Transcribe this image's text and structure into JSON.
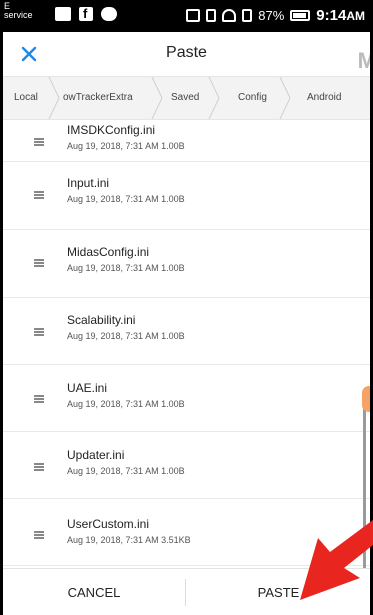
{
  "statusbar": {
    "carrier_line1": "E",
    "carrier_line2": "service",
    "battery": "87%",
    "time": "9:14",
    "ampm": "AM"
  },
  "dialog": {
    "title": "Paste",
    "background_text": "M",
    "breadcrumb": [
      "Local",
      "owTrackerExtra",
      "Saved",
      "Config",
      "Android"
    ],
    "files": [
      {
        "name": "IMSDKConfig.ini",
        "meta": "Aug 19, 2018, 7:31 AM 1.00B"
      },
      {
        "name": "Input.ini",
        "meta": "Aug 19, 2018, 7:31 AM 1.00B"
      },
      {
        "name": "MidasConfig.ini",
        "meta": "Aug 19, 2018, 7:31 AM 1.00B"
      },
      {
        "name": "Scalability.ini",
        "meta": "Aug 19, 2018, 7:31 AM 1.00B"
      },
      {
        "name": "UAE.ini",
        "meta": "Aug 19, 2018, 7:31 AM 1.00B"
      },
      {
        "name": "Updater.ini",
        "meta": "Aug 19, 2018, 7:31 AM 1.00B"
      },
      {
        "name": "UserCustom.ini",
        "meta": "Aug 19, 2018, 7:31 AM 3.51KB"
      }
    ],
    "cancel_label": "CANCEL",
    "paste_label": "PASTE"
  },
  "colors": {
    "accent": "#1e88e5",
    "annotation_arrow": "#e8251f"
  },
  "icons": [
    "close-icon",
    "file-icon",
    "chevron-right-icon",
    "battery-icon",
    "wifi-icon"
  ]
}
